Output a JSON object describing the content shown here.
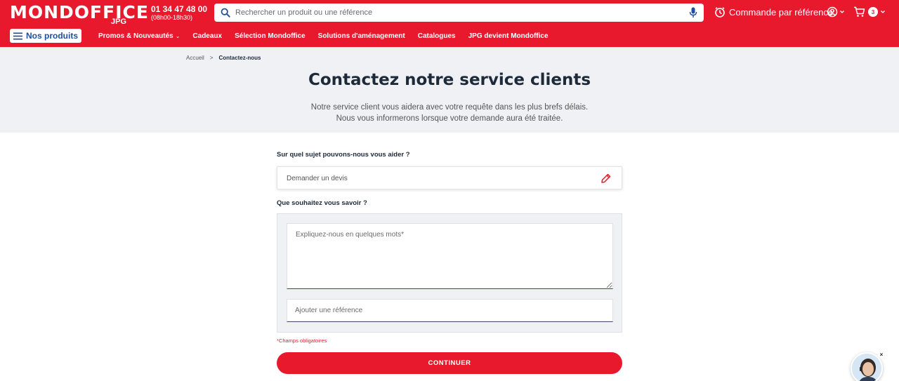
{
  "header": {
    "logo": {
      "main": "MONDOFFICE",
      "sub": "JPG"
    },
    "phone": {
      "number": "01 34 47 48 00",
      "hours": "(08h00-18h30)"
    },
    "search": {
      "placeholder": "Rechercher un produit ou une référence",
      "icon": "search-icon",
      "voice_icon": "microphone-icon"
    },
    "order_by_reference": {
      "label": "Commande par référence",
      "icon": "clock-icon"
    },
    "account": {
      "icon": "user-circle-icon"
    },
    "cart": {
      "icon": "cart-icon",
      "count": "3"
    },
    "brand_color": "#e8192c"
  },
  "nav": {
    "products_button": "Nos produits",
    "links": [
      {
        "label": "Promos & Nouveautés",
        "has_dropdown": true
      },
      {
        "label": "Cadeaux"
      },
      {
        "label": "Sélection Mondoffice"
      },
      {
        "label": "Solutions d'aménagement"
      },
      {
        "label": "Catalogues"
      },
      {
        "label": "JPG devient Mondoffice"
      }
    ]
  },
  "breadcrumb": {
    "home": "Accueil",
    "separator": ">",
    "current": "Contactez-nous"
  },
  "hero": {
    "title": "Contactez notre service clients",
    "subtitle_line1": "Notre service client vous aidera avec votre requête dans les plus brefs délais.",
    "subtitle_line2": "Nous vous informerons lorsque votre demande aura été traitée."
  },
  "form": {
    "subject_label": "Sur quel sujet pouvons-nous vous aider ?",
    "subject_value": "Demander un devis",
    "question_label": "Que souhaitez vous savoir ?",
    "message_placeholder": "Expliquez-nous en quelques mots*",
    "reference_placeholder": "Ajouter une référence",
    "required_note": "*Champs obligatoires",
    "submit_label": "CONTINUER"
  },
  "chat": {
    "icon": "support-agent-avatar",
    "close_icon": "close-icon"
  }
}
